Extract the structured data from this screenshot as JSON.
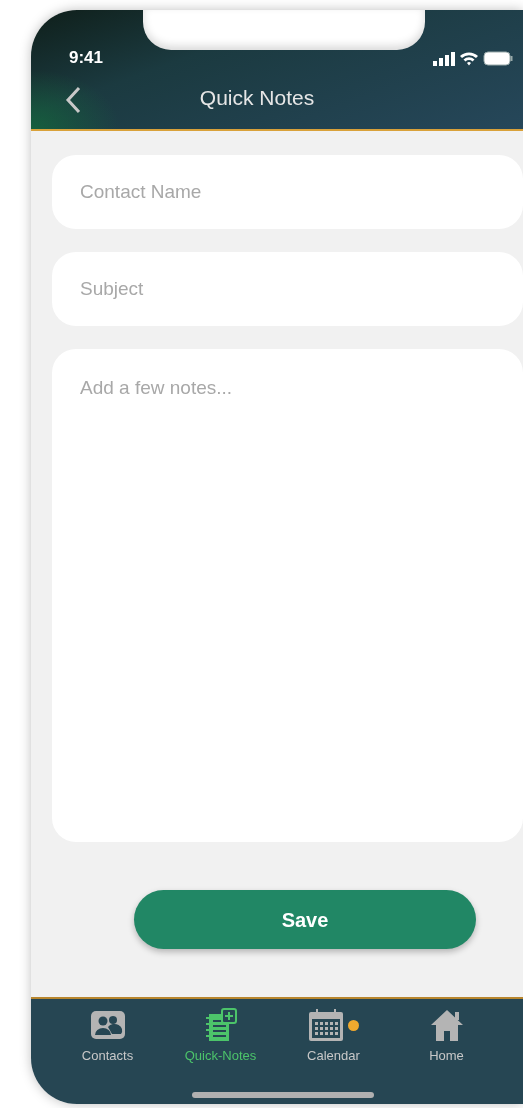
{
  "status_bar": {
    "time": "9:41"
  },
  "header": {
    "title": "Quick Notes"
  },
  "form": {
    "fields": [
      {
        "kind": "line",
        "placeholder": "Contact Name"
      },
      {
        "kind": "line",
        "placeholder": "Subject"
      },
      {
        "kind": "area",
        "placeholder": "Add a few notes..."
      }
    ],
    "save_button": "Save"
  },
  "tab_bar": [
    {
      "label": "Contacts",
      "kind": "contacts",
      "selected": false,
      "dot": false
    },
    {
      "label": "Quick-Notes",
      "kind": "notes",
      "selected": true,
      "dot": false
    },
    {
      "label": "Calendar",
      "kind": "calendar",
      "selected": false,
      "dot": true
    },
    {
      "label": "Home",
      "kind": "home",
      "selected": false,
      "dot": false
    }
  ]
}
